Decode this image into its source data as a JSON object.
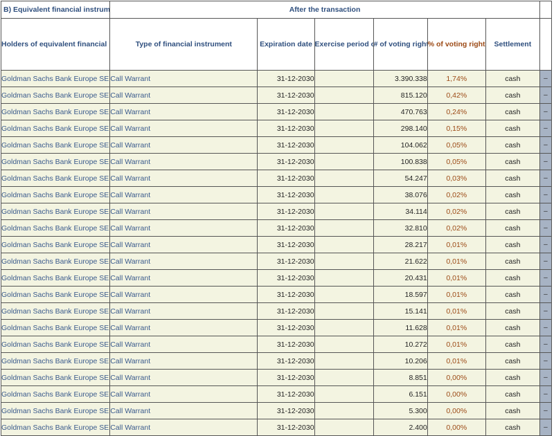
{
  "section_title": "B) Equivalent financial instruments",
  "group_title": "After the transaction",
  "columns": {
    "holder": "Holders of equivalent financial instruments",
    "type": "Type of financial instrument",
    "expiration": "Expiration date",
    "exercise": "Exercise period or date",
    "voting_rights": "# of voting rights that may be acquired if the instrument is exercised",
    "pct": "% of voting rights",
    "settlement": "Settlement"
  },
  "side_marker": "–",
  "colors": {
    "header_text": "#2f4f7e",
    "pct_text": "#9c4a16",
    "row_bg": "#f3f4e1",
    "side_bg": "#a7b3c4"
  },
  "rows": [
    {
      "holder": "Goldman Sachs Bank Europe SE",
      "type": "Call Warrant",
      "expiration": "31-12-2030",
      "exercise": "",
      "voting": "3.390.338",
      "pct": "1,74%",
      "settlement": "cash"
    },
    {
      "holder": "Goldman Sachs Bank Europe SE",
      "type": "Call Warrant",
      "expiration": "31-12-2030",
      "exercise": "",
      "voting": "815.120",
      "pct": "0,42%",
      "settlement": "cash"
    },
    {
      "holder": "Goldman Sachs Bank Europe SE",
      "type": "Call Warrant",
      "expiration": "31-12-2030",
      "exercise": "",
      "voting": "470.763",
      "pct": "0,24%",
      "settlement": "cash"
    },
    {
      "holder": "Goldman Sachs Bank Europe SE",
      "type": "Call Warrant",
      "expiration": "31-12-2030",
      "exercise": "",
      "voting": "298.140",
      "pct": "0,15%",
      "settlement": "cash"
    },
    {
      "holder": "Goldman Sachs Bank Europe SE",
      "type": "Call Warrant",
      "expiration": "31-12-2030",
      "exercise": "",
      "voting": "104.062",
      "pct": "0,05%",
      "settlement": "cash"
    },
    {
      "holder": "Goldman Sachs Bank Europe SE",
      "type": "Call Warrant",
      "expiration": "31-12-2030",
      "exercise": "",
      "voting": "100.838",
      "pct": "0,05%",
      "settlement": "cash"
    },
    {
      "holder": "Goldman Sachs Bank Europe SE",
      "type": "Call Warrant",
      "expiration": "31-12-2030",
      "exercise": "",
      "voting": "54.247",
      "pct": "0,03%",
      "settlement": "cash"
    },
    {
      "holder": "Goldman Sachs Bank Europe SE",
      "type": "Call Warrant",
      "expiration": "31-12-2030",
      "exercise": "",
      "voting": "38.076",
      "pct": "0,02%",
      "settlement": "cash"
    },
    {
      "holder": "Goldman Sachs Bank Europe SE",
      "type": "Call Warrant",
      "expiration": "31-12-2030",
      "exercise": "",
      "voting": "34.114",
      "pct": "0,02%",
      "settlement": "cash"
    },
    {
      "holder": "Goldman Sachs Bank Europe SE",
      "type": "Call Warrant",
      "expiration": "31-12-2030",
      "exercise": "",
      "voting": "32.810",
      "pct": "0,02%",
      "settlement": "cash"
    },
    {
      "holder": "Goldman Sachs Bank Europe SE",
      "type": "Call Warrant",
      "expiration": "31-12-2030",
      "exercise": "",
      "voting": "28.217",
      "pct": "0,01%",
      "settlement": "cash"
    },
    {
      "holder": "Goldman Sachs Bank Europe SE",
      "type": "Call Warrant",
      "expiration": "31-12-2030",
      "exercise": "",
      "voting": "21.622",
      "pct": "0,01%",
      "settlement": "cash"
    },
    {
      "holder": "Goldman Sachs Bank Europe SE",
      "type": "Call Warrant",
      "expiration": "31-12-2030",
      "exercise": "",
      "voting": "20.431",
      "pct": "0,01%",
      "settlement": "cash"
    },
    {
      "holder": "Goldman Sachs Bank Europe SE",
      "type": "Call Warrant",
      "expiration": "31-12-2030",
      "exercise": "",
      "voting": "18.597",
      "pct": "0,01%",
      "settlement": "cash"
    },
    {
      "holder": "Goldman Sachs Bank Europe SE",
      "type": "Call Warrant",
      "expiration": "31-12-2030",
      "exercise": "",
      "voting": "15.141",
      "pct": "0,01%",
      "settlement": "cash"
    },
    {
      "holder": "Goldman Sachs Bank Europe SE",
      "type": "Call Warrant",
      "expiration": "31-12-2030",
      "exercise": "",
      "voting": "11.628",
      "pct": "0,01%",
      "settlement": "cash"
    },
    {
      "holder": "Goldman Sachs Bank Europe SE",
      "type": "Call Warrant",
      "expiration": "31-12-2030",
      "exercise": "",
      "voting": "10.272",
      "pct": "0,01%",
      "settlement": "cash"
    },
    {
      "holder": "Goldman Sachs Bank Europe SE",
      "type": "Call Warrant",
      "expiration": "31-12-2030",
      "exercise": "",
      "voting": "10.206",
      "pct": "0,01%",
      "settlement": "cash"
    },
    {
      "holder": "Goldman Sachs Bank Europe SE",
      "type": "Call Warrant",
      "expiration": "31-12-2030",
      "exercise": "",
      "voting": "8.851",
      "pct": "0,00%",
      "settlement": "cash"
    },
    {
      "holder": "Goldman Sachs Bank Europe SE",
      "type": "Call Warrant",
      "expiration": "31-12-2030",
      "exercise": "",
      "voting": "6.151",
      "pct": "0,00%",
      "settlement": "cash"
    },
    {
      "holder": "Goldman Sachs Bank Europe SE",
      "type": "Call Warrant",
      "expiration": "31-12-2030",
      "exercise": "",
      "voting": "5.300",
      "pct": "0,00%",
      "settlement": "cash"
    },
    {
      "holder": "Goldman Sachs Bank Europe SE",
      "type": "Call Warrant",
      "expiration": "31-12-2030",
      "exercise": "",
      "voting": "2.400",
      "pct": "0,00%",
      "settlement": "cash"
    }
  ]
}
